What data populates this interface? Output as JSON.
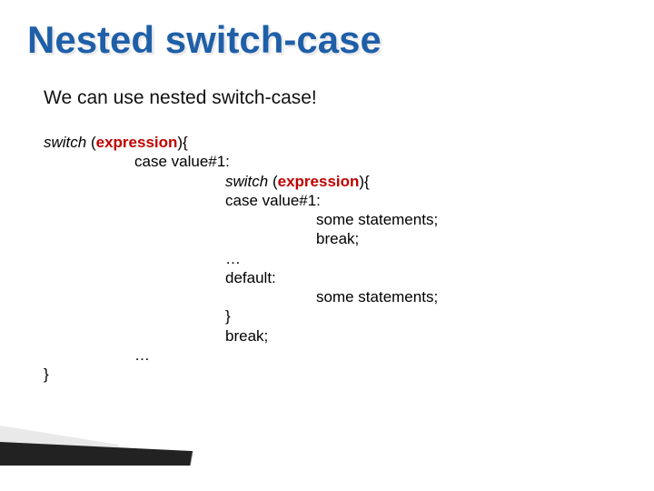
{
  "title": "Nested switch-case",
  "intro": "We can use nested switch-case!",
  "code": {
    "switch_kw": "switch",
    "paren_open": " (",
    "expression": "expression",
    "paren_close_brace": "){",
    "case1": "case value#1:",
    "some_stmts": "some statements;",
    "break": "break;",
    "ellipsis": "…",
    "default": "default:",
    "close_brace": "}"
  }
}
